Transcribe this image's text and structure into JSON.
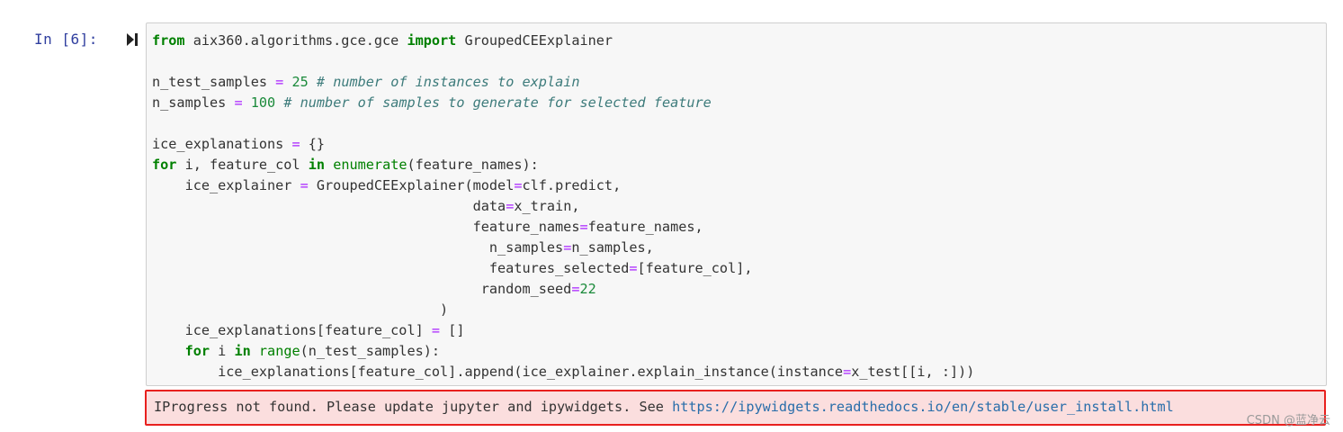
{
  "cell": {
    "prompt": "In  [6]:",
    "run_icon": "run-cell-icon",
    "code_lines": [
      [
        {
          "t": "from",
          "c": "kw"
        },
        {
          "t": " aix360.algorithms.gce.gce ",
          "c": ""
        },
        {
          "t": "import",
          "c": "kw"
        },
        {
          "t": " GroupedCEExplainer",
          "c": ""
        }
      ],
      [],
      [
        {
          "t": "n_test_samples ",
          "c": ""
        },
        {
          "t": "=",
          "c": "op"
        },
        {
          "t": " ",
          "c": ""
        },
        {
          "t": "25",
          "c": "num"
        },
        {
          "t": " ",
          "c": ""
        },
        {
          "t": "# number of instances to explain",
          "c": "cm"
        }
      ],
      [
        {
          "t": "n_samples ",
          "c": ""
        },
        {
          "t": "=",
          "c": "op"
        },
        {
          "t": " ",
          "c": ""
        },
        {
          "t": "100",
          "c": "num"
        },
        {
          "t": " ",
          "c": ""
        },
        {
          "t": "# number of samples to generate for selected feature",
          "c": "cm"
        }
      ],
      [],
      [
        {
          "t": "ice_explanations ",
          "c": ""
        },
        {
          "t": "=",
          "c": "op"
        },
        {
          "t": " {}",
          "c": ""
        }
      ],
      [
        {
          "t": "for",
          "c": "kw"
        },
        {
          "t": " i, feature_col ",
          "c": ""
        },
        {
          "t": "in",
          "c": "kw"
        },
        {
          "t": " ",
          "c": ""
        },
        {
          "t": "enumerate",
          "c": "nb"
        },
        {
          "t": "(feature_names):",
          "c": ""
        }
      ],
      [
        {
          "t": "    ice_explainer ",
          "c": ""
        },
        {
          "t": "=",
          "c": "op"
        },
        {
          "t": " GroupedCEExplainer(model",
          "c": ""
        },
        {
          "t": "=",
          "c": "op"
        },
        {
          "t": "clf.predict,",
          "c": ""
        }
      ],
      [
        {
          "t": "                                       data",
          "c": ""
        },
        {
          "t": "=",
          "c": "op"
        },
        {
          "t": "x_train,",
          "c": ""
        }
      ],
      [
        {
          "t": "                                       feature_names",
          "c": ""
        },
        {
          "t": "=",
          "c": "op"
        },
        {
          "t": "feature_names,",
          "c": ""
        }
      ],
      [
        {
          "t": "                                         n_samples",
          "c": ""
        },
        {
          "t": "=",
          "c": "op"
        },
        {
          "t": "n_samples,",
          "c": ""
        }
      ],
      [
        {
          "t": "                                         features_selected",
          "c": ""
        },
        {
          "t": "=",
          "c": "op"
        },
        {
          "t": "[feature_col],",
          "c": ""
        }
      ],
      [
        {
          "t": "                                        random_seed",
          "c": ""
        },
        {
          "t": "=",
          "c": "op"
        },
        {
          "t": "22",
          "c": "num"
        }
      ],
      [
        {
          "t": "                                   )",
          "c": ""
        }
      ],
      [
        {
          "t": "    ice_explanations[feature_col] ",
          "c": ""
        },
        {
          "t": "=",
          "c": "op"
        },
        {
          "t": " []",
          "c": ""
        }
      ],
      [
        {
          "t": "    ",
          "c": ""
        },
        {
          "t": "for",
          "c": "kw"
        },
        {
          "t": " i ",
          "c": ""
        },
        {
          "t": "in",
          "c": "kw"
        },
        {
          "t": " ",
          "c": ""
        },
        {
          "t": "range",
          "c": "nb"
        },
        {
          "t": "(n_test_samples):",
          "c": ""
        }
      ],
      [
        {
          "t": "        ice_explanations[feature_col].append(ice_explainer.explain_instance(instance",
          "c": ""
        },
        {
          "t": "=",
          "c": "op"
        },
        {
          "t": "x_test[[i, :]))",
          "c": ""
        }
      ]
    ]
  },
  "output": {
    "message": "IProgress not found. Please update jupyter and ipywidgets. See ",
    "link_text": "https://ipywidgets.readthedocs.io/en/stable/user_install.html",
    "highlight_color": "#e8201e"
  },
  "watermark": "CSDN @蓝净云"
}
